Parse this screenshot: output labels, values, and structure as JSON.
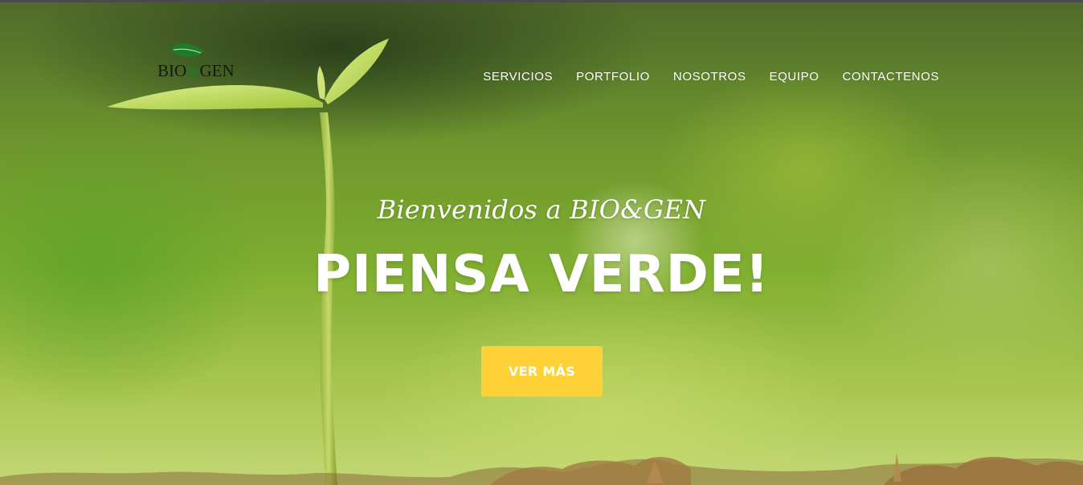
{
  "header": {
    "logo": {
      "text_left": "BIO",
      "text_amp": "&",
      "text_right": "GEN"
    },
    "nav": {
      "items": [
        {
          "label": "SERVICIOS"
        },
        {
          "label": "PORTFOLIO"
        },
        {
          "label": "NOSOTROS"
        },
        {
          "label": "EQUIPO"
        },
        {
          "label": "CONTACTENOS"
        }
      ]
    }
  },
  "hero": {
    "subtitle": "Bienvenidos a BIO&GEN",
    "title": "PIENSA VERDE!",
    "cta_label": "VER MÁS"
  },
  "colors": {
    "cta_background": "#fed136",
    "nav_text": "#ffffff",
    "logo_text": "#121a10",
    "logo_leaf": "#1f7a2c"
  }
}
